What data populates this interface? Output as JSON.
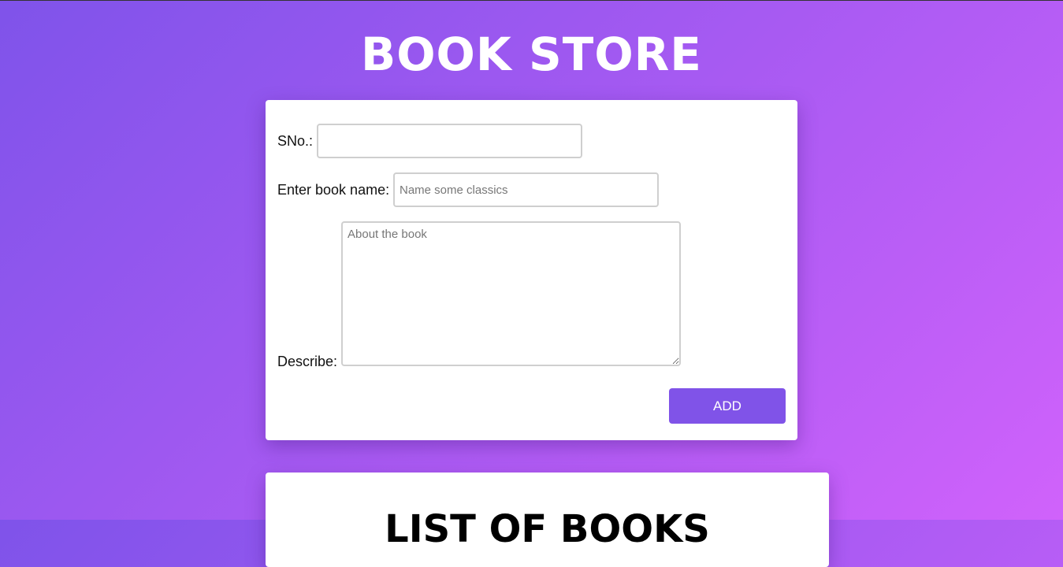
{
  "header": {
    "title": "BOOK STORE"
  },
  "form": {
    "sno_label": "SNo.:",
    "sno_value": "",
    "book_name_label": "Enter book name:",
    "book_name_placeholder": "Name some classics",
    "describe_label": "Describe:",
    "describe_placeholder": "About the book",
    "add_button_label": "ADD"
  },
  "list": {
    "title": "LIST OF BOOKS"
  },
  "colors": {
    "gradient_start": "#7f53ea",
    "gradient_end": "#d062fb",
    "button": "#8053e8",
    "card": "#ffffff"
  }
}
